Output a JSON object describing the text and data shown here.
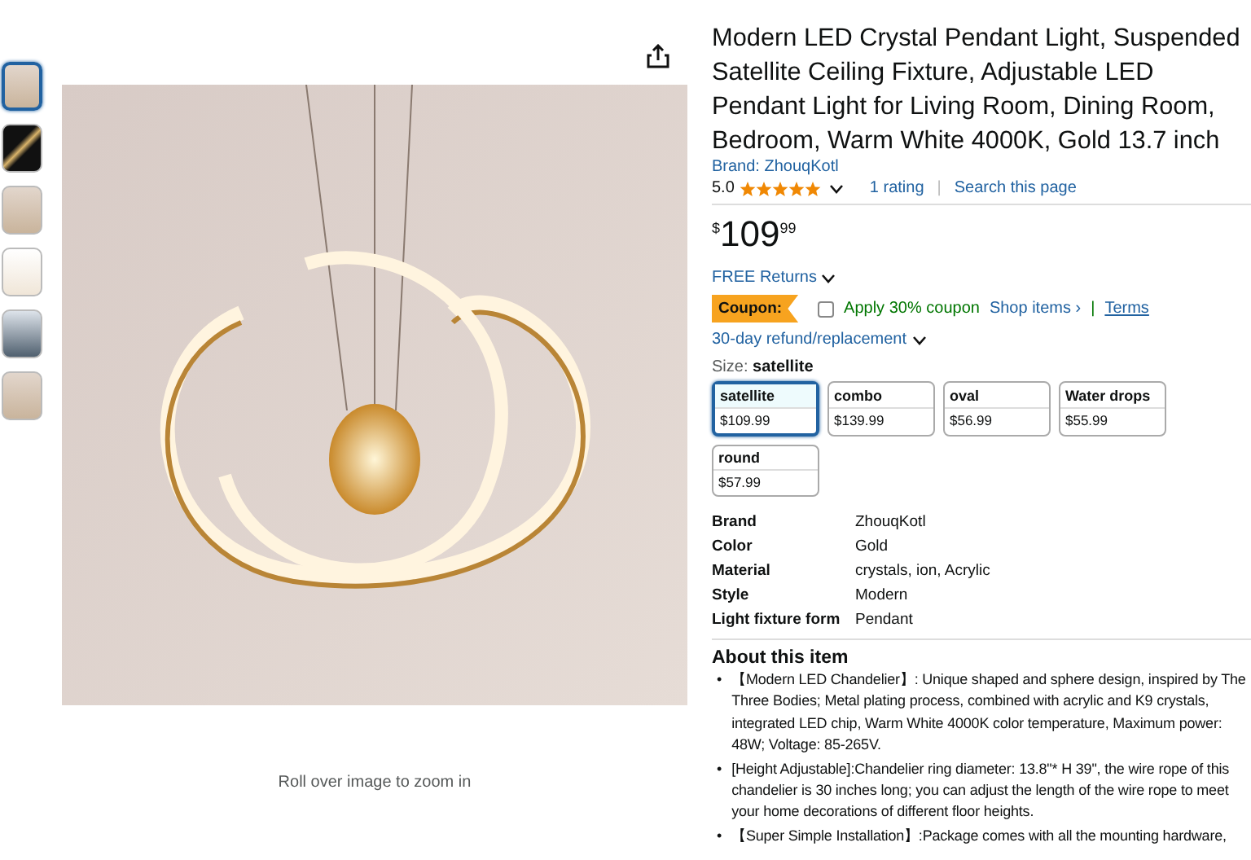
{
  "thumbnails": [
    {
      "selected": true
    },
    {
      "selected": false
    },
    {
      "selected": false
    },
    {
      "selected": false
    },
    {
      "selected": false
    },
    {
      "selected": false
    }
  ],
  "image_caption": "Roll over image to zoom in",
  "product": {
    "title": "Modern LED Crystal Pendant Light, Suspended Satellite Ceiling Fixture, Adjustable LED Pendant Light for Living Room, Dining Room, Bedroom, Warm White 4000K, Gold 13.7 inch",
    "brand_link": "Brand: ZhouqKotl",
    "rating": {
      "score": "5.0",
      "stars": 5,
      "count": "1 rating",
      "separator": "|",
      "search": "Search this page"
    },
    "price": {
      "symbol": "$",
      "whole": "109",
      "fraction": "99"
    },
    "returns": "FREE Returns",
    "coupon": {
      "badge": "Coupon:",
      "checked": false,
      "label": "Apply 30% coupon",
      "shop": "Shop items ›",
      "separator": "|",
      "terms": "Terms"
    },
    "refund": "30-day refund/replacement",
    "size": {
      "label": "Size:",
      "value": "satellite"
    },
    "swatches": [
      {
        "name": "satellite",
        "price": "$109.99",
        "selected": true
      },
      {
        "name": "combo",
        "price": "$139.99",
        "selected": false
      },
      {
        "name": "oval",
        "price": "$56.99",
        "selected": false
      },
      {
        "name": "Water drops",
        "price": "$55.99",
        "selected": false
      },
      {
        "name": "round",
        "price": "$57.99",
        "selected": false
      }
    ],
    "specs": [
      {
        "key": "Brand",
        "value": "ZhouqKotl"
      },
      {
        "key": "Color",
        "value": "Gold"
      },
      {
        "key": "Material",
        "value": "crystals, ion, Acrylic"
      },
      {
        "key": "Style",
        "value": "Modern"
      },
      {
        "key": "Light fixture form",
        "value": "Pendant"
      }
    ],
    "about": {
      "heading": "About this item",
      "bullets": [
        {
          "mark": "•",
          "text": "【Modern LED Chandelier】: Unique shaped and sphere design, inspired by The Three Bodies; Metal plating process, combined with acrylic and K9 crystals, integrated LED chip, Warm White 4000K color temperature, Maximum power: 48W; Voltage: 85-265V."
        },
        {
          "mark": "•",
          "text": "[Height Adjustable]:Chandelier ring diameter: 13.8\"* H 39\", the wire rope of this chandelier is 30 inches long; you can adjust the length of the wire rope to meet your home decorations of different floor heights."
        },
        {
          "mark": "•",
          "text": "【Super Simple Installation】:Package comes with all the mounting hardware,"
        }
      ]
    }
  }
}
